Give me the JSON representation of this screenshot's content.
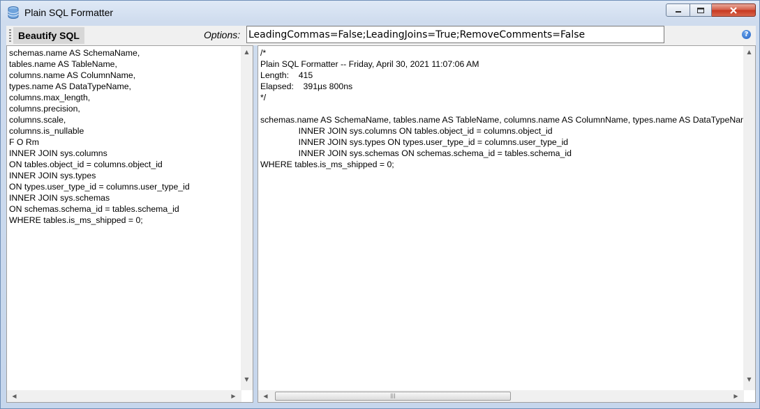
{
  "window": {
    "title": "Plain SQL Formatter"
  },
  "toolbar": {
    "beautify_label": "Beautify SQL",
    "options_label": "Options:",
    "options_value": "LeadingCommas=False;LeadingJoins=True;RemoveComments=False",
    "help_glyph": "?"
  },
  "input_sql": {
    "lines": [
      "schemas.name AS SchemaName,",
      "tables.name AS TableName,",
      "columns.name AS ColumnName,",
      "types.name AS DataTypeName,",
      "columns.max_length,",
      "columns.precision,",
      "columns.scale,",
      "columns.is_nullable",
      "F O Rm",
      "INNER JOIN sys.columns",
      "ON tables.object_id = columns.object_id",
      "INNER JOIN sys.types",
      "ON types.user_type_id = columns.user_type_id",
      "INNER JOIN sys.schemas",
      "ON schemas.schema_id = tables.schema_id",
      "WHERE tables.is_ms_shipped = 0;"
    ]
  },
  "output_sql": {
    "lines": [
      "/*",
      "Plain SQL Formatter -- Friday, April 30, 2021 11:07:06 AM",
      "Length:    415",
      "Elapsed:    391µs 800ns",
      "*/",
      "",
      "schemas.name AS SchemaName, tables.name AS TableName, columns.name AS ColumnName, types.name AS DataTypeName",
      "                INNER JOIN sys.columns ON tables.object_id = columns.object_id",
      "                INNER JOIN sys.types ON types.user_type_id = columns.user_type_id",
      "                INNER JOIN sys.schemas ON schemas.schema_id = tables.schema_id",
      "WHERE tables.is_ms_shipped = 0;"
    ]
  },
  "icons": {
    "app": "database-icon",
    "help": "help-icon"
  },
  "colors": {
    "window_frame": "#dbe6f4",
    "close_button": "#c6371f",
    "help_icon": "#1f5fc4"
  }
}
